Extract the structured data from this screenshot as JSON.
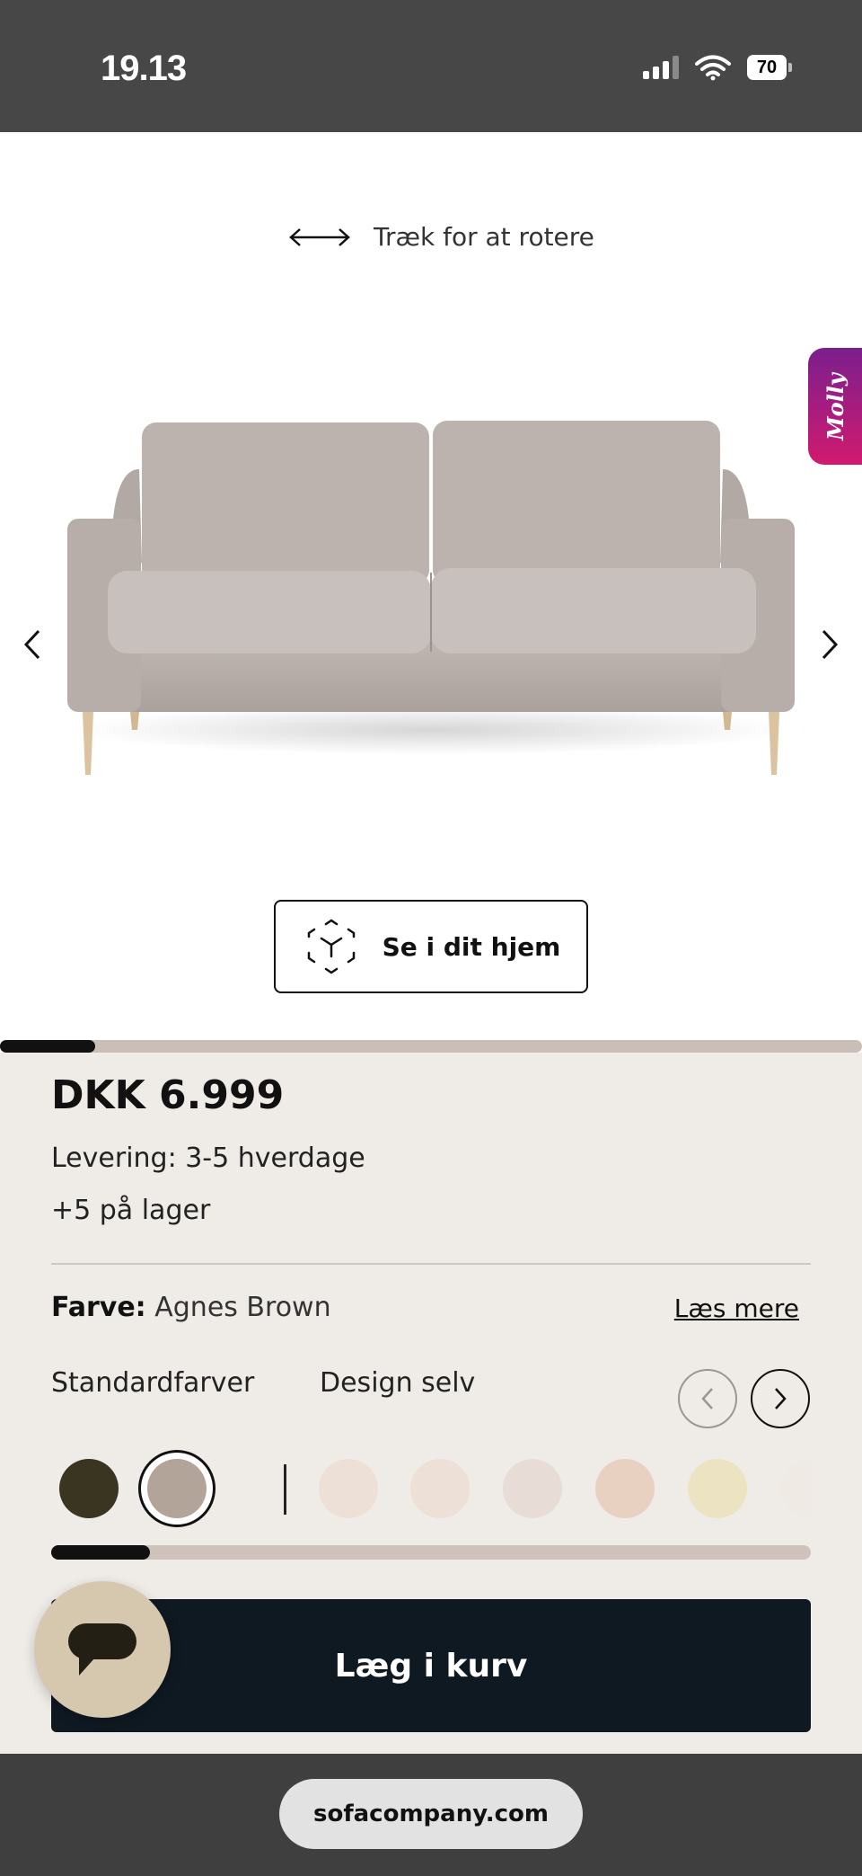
{
  "status_bar": {
    "time": "19.13"
  },
  "viewer": {
    "rotate_hint": "Træk for at rotere",
    "molly_label": "Molly",
    "ar_button_label": "Se i dit hjem",
    "image_progress": 0.11
  },
  "product": {
    "price": "DKK 6.999",
    "delivery": "Levering: 3-5 hverdage",
    "stock": "+5 på lager",
    "color_label": "Farve:",
    "color_value": "Agnes Brown",
    "read_more": "Læs mere"
  },
  "color_tabs": {
    "standard": "Standardfarver",
    "custom": "Design selv"
  },
  "swatches": {
    "colors": [
      "#3a3520",
      "#b3a49a",
      "#ede0d6",
      "#ede0d6",
      "#e8ddd6",
      "#e9d1c1",
      "#ece3c3",
      "#efeae3"
    ],
    "selected_index": 1,
    "progress": 0.13
  },
  "cart": {
    "label": "Læg i kurv",
    "background": "#0f1922"
  },
  "browser": {
    "url": "sofacompany.com"
  }
}
